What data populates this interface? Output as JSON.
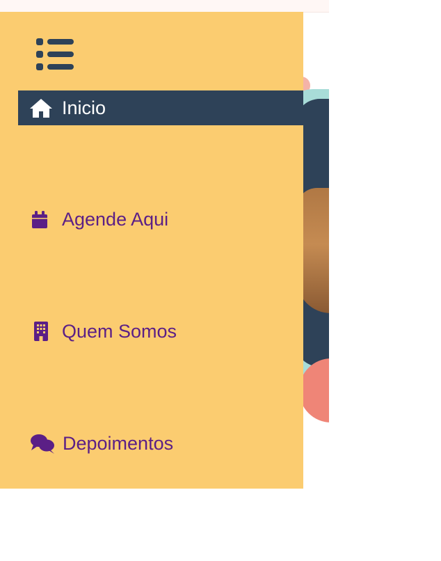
{
  "colors": {
    "drawer_bg": "#fbcc70",
    "active_bg": "#2e4258",
    "active_text": "#ffffff",
    "link_text": "#5b1f86"
  },
  "menu": {
    "toggle_icon": "list-icon",
    "items": [
      {
        "label": "Inicio",
        "icon": "home-icon",
        "active": true
      },
      {
        "label": "Agende Aqui",
        "icon": "calendar-icon",
        "active": false
      },
      {
        "label": "Quem Somos",
        "icon": "building-icon",
        "active": false
      },
      {
        "label": "Depoimentos",
        "icon": "comments-icon",
        "active": false
      }
    ]
  }
}
